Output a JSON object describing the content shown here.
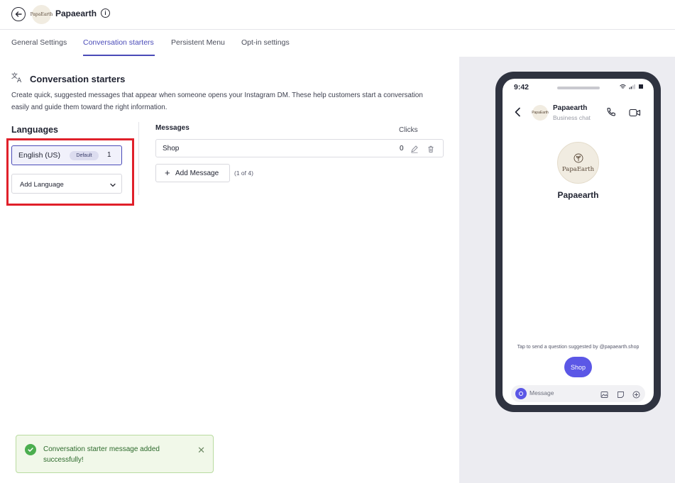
{
  "header": {
    "app_title": "Papaearth",
    "logo_text": "PapaEarth"
  },
  "tabs": [
    {
      "label": "General Settings",
      "active": false
    },
    {
      "label": "Conversation starters",
      "active": true
    },
    {
      "label": "Persistent Menu",
      "active": false
    },
    {
      "label": "Opt-in settings",
      "active": false
    }
  ],
  "section": {
    "title": "Conversation starters",
    "description": "Create quick, suggested messages that appear when someone opens your Instagram DM. These help customers start a conversation easily and guide them toward the right information."
  },
  "languages": {
    "heading": "Languages",
    "selected": {
      "name": "English (US)",
      "badge": "Default",
      "count": "1"
    },
    "add_label": "Add Language"
  },
  "messages": {
    "heading": "Messages",
    "clicks_heading": "Clicks",
    "rows": [
      {
        "text": "Shop",
        "clicks": "0"
      }
    ],
    "add_label": "Add Message",
    "count_label": "(1 of 4)"
  },
  "preview": {
    "status_time": "9:42",
    "chat_name": "Papaearth",
    "chat_subtitle": "Business chat",
    "avatar_text": "PapaEarth",
    "profile_name": "Papaearth",
    "suggest_note": "Tap to send a question suggested by @papaearth.shop",
    "chip_label": "Shop",
    "composer_placeholder": "Message"
  },
  "toast": {
    "message": "Conversation starter message added successfully!"
  },
  "colors": {
    "accent": "#4a4bb8",
    "chip": "#5b57e6",
    "highlight": "#e0202a",
    "success": "#4bae4f"
  }
}
